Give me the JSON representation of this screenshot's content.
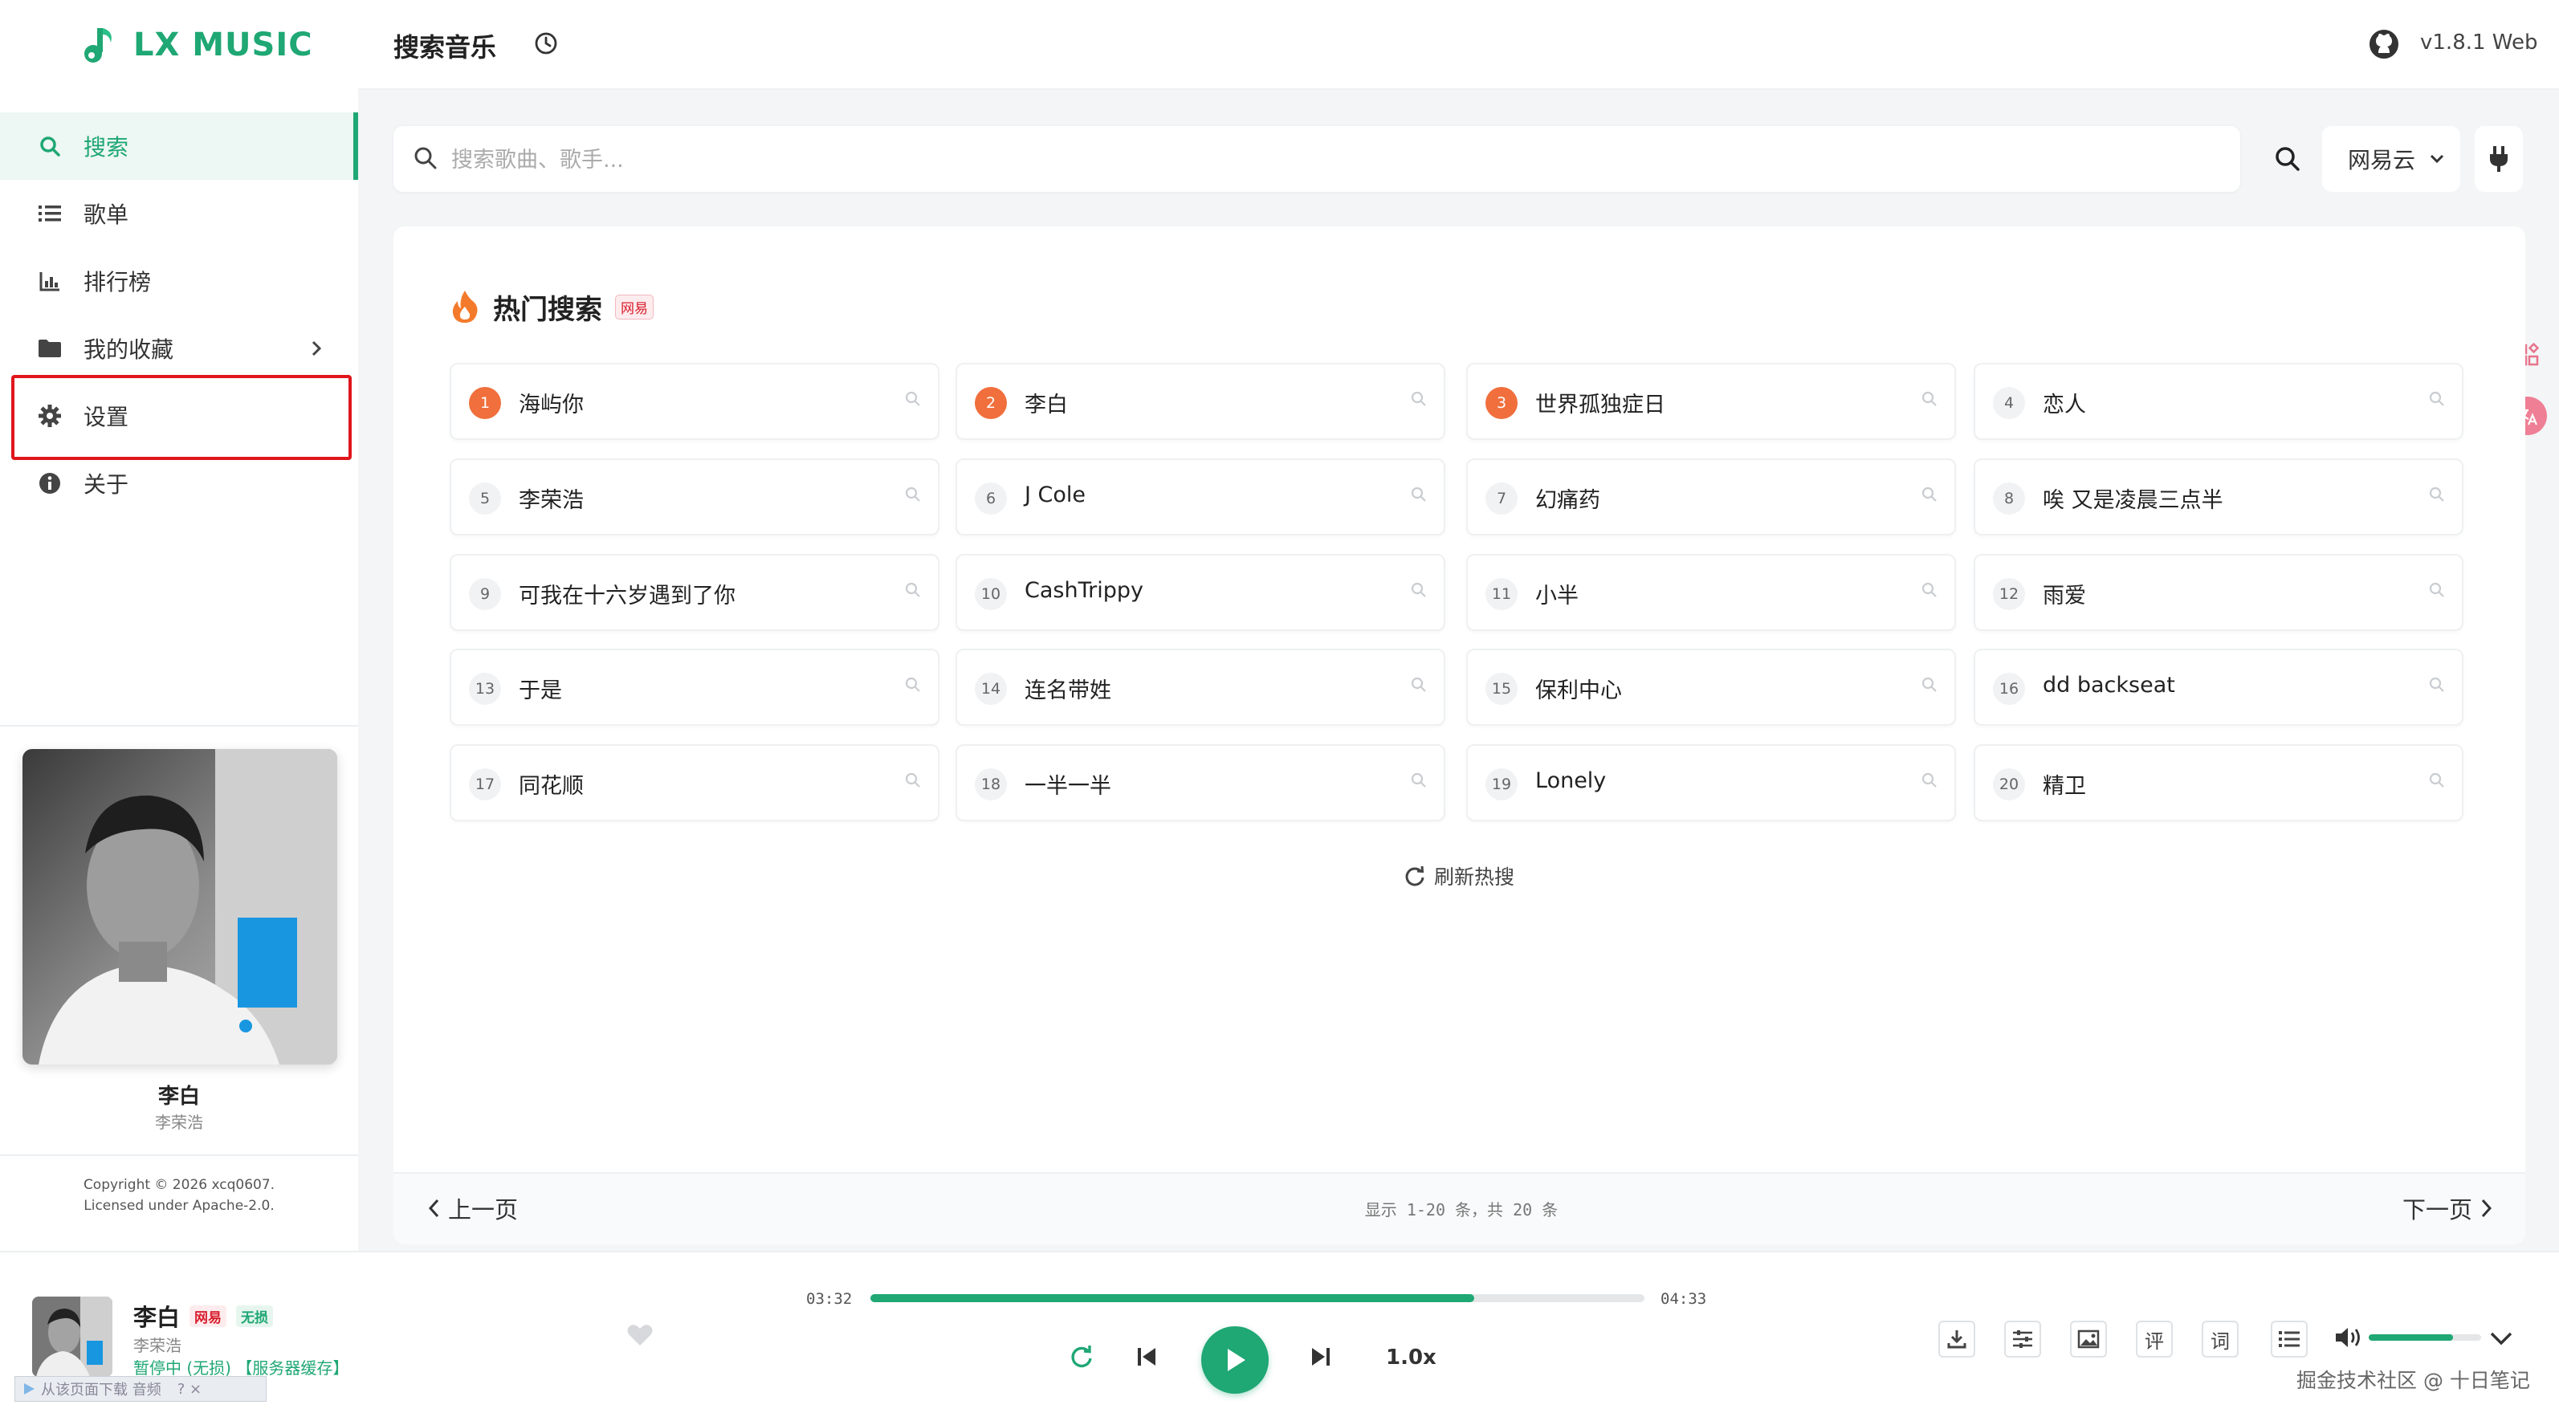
{
  "app": {
    "name": "LX MUSIC",
    "version": "v1.8.1 Web",
    "accent": "#1fa774"
  },
  "sidebar": {
    "items": [
      {
        "label": "搜索",
        "icon": "search-icon",
        "active": true
      },
      {
        "label": "歌单",
        "icon": "list-icon"
      },
      {
        "label": "排行榜",
        "icon": "chart-icon"
      },
      {
        "label": "我的收藏",
        "icon": "folder-icon",
        "has_arrow": true
      },
      {
        "label": "设置",
        "icon": "gear-icon",
        "highlighted": true
      },
      {
        "label": "关于",
        "icon": "info-icon"
      }
    ],
    "now_song": "李白",
    "now_artist": "李荣浩",
    "copyright_line1": "Copyright © 2026 xcq0607.",
    "copyright_line2": "Licensed under Apache-2.0."
  },
  "header": {
    "title": "搜索音乐",
    "history_icon": "clock-icon",
    "github_icon": "github-icon"
  },
  "search": {
    "placeholder": "搜索歌曲、歌手...",
    "value": "",
    "source": "网易云"
  },
  "hot": {
    "title": "热门搜索",
    "source_badge": "网易",
    "items": [
      {
        "rank": "1",
        "text": "海屿你"
      },
      {
        "rank": "2",
        "text": "李白"
      },
      {
        "rank": "3",
        "text": "世界孤独症日"
      },
      {
        "rank": "4",
        "text": "恋人"
      },
      {
        "rank": "5",
        "text": "李荣浩"
      },
      {
        "rank": "6",
        "text": "J Cole"
      },
      {
        "rank": "7",
        "text": "幻痛药"
      },
      {
        "rank": "8",
        "text": "唉 又是凌晨三点半"
      },
      {
        "rank": "9",
        "text": "可我在十六岁遇到了你"
      },
      {
        "rank": "10",
        "text": "CashTrippy"
      },
      {
        "rank": "11",
        "text": "小半"
      },
      {
        "rank": "12",
        "text": "雨爱"
      },
      {
        "rank": "13",
        "text": "于是"
      },
      {
        "rank": "14",
        "text": "连名带姓"
      },
      {
        "rank": "15",
        "text": "保利中心"
      },
      {
        "rank": "16",
        "text": "dd backseat"
      },
      {
        "rank": "17",
        "text": "同花顺"
      },
      {
        "rank": "18",
        "text": "一半一半"
      },
      {
        "rank": "19",
        "text": "Lonely"
      },
      {
        "rank": "20",
        "text": "精卫"
      }
    ],
    "refresh_label": "刷新热搜"
  },
  "pager": {
    "prev": "上一页",
    "next": "下一页",
    "info": "显示 1-20 条，共 20 条"
  },
  "player": {
    "title": "李白",
    "source_tag": "网易",
    "quality_tag": "无损",
    "artist": "李荣浩",
    "status": "暂停中 (无损) 【服务器缓存】",
    "download_hint": "从该页面下载 音频",
    "download_hint_extra": "? ×",
    "current_time": "03:32",
    "total_time": "04:33",
    "progress": 0.78,
    "speed": "1.0x",
    "volume": 0.75,
    "tools": [
      "download-icon",
      "equalizer-icon",
      "image-icon",
      "评",
      "词",
      "playlist-icon"
    ]
  },
  "watermark": "掘金技术社区 @ 十日笔记"
}
